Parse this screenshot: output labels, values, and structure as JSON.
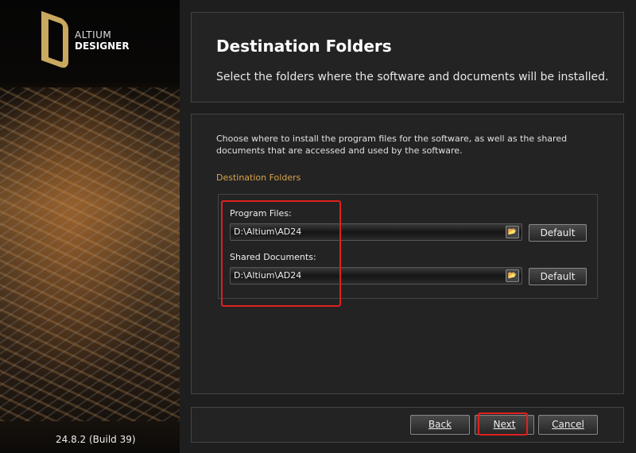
{
  "sidebar": {
    "logo_line1": "ALTIUM",
    "logo_line2": "DESIGNER",
    "version": "24.8.2 (Build 39)"
  },
  "header": {
    "title": "Destination Folders",
    "subtitle": "Select the folders where the software and documents will be installed."
  },
  "main": {
    "description": "Choose where to install the program files for the software, as well as the shared documents that are accessed and used by the software.",
    "section": "Destination Folders",
    "program_files": {
      "label": "Program Files:",
      "value": "D:\\Altium\\AD24",
      "default_label": "Default"
    },
    "shared_documents": {
      "label": "Shared Documents:",
      "value": "D:\\Altium\\AD24",
      "default_label": "Default"
    }
  },
  "footer": {
    "back": "Back",
    "next": "Next",
    "cancel": "Cancel"
  },
  "colors": {
    "accent": "#d9a44a",
    "highlight": "#e02020"
  }
}
